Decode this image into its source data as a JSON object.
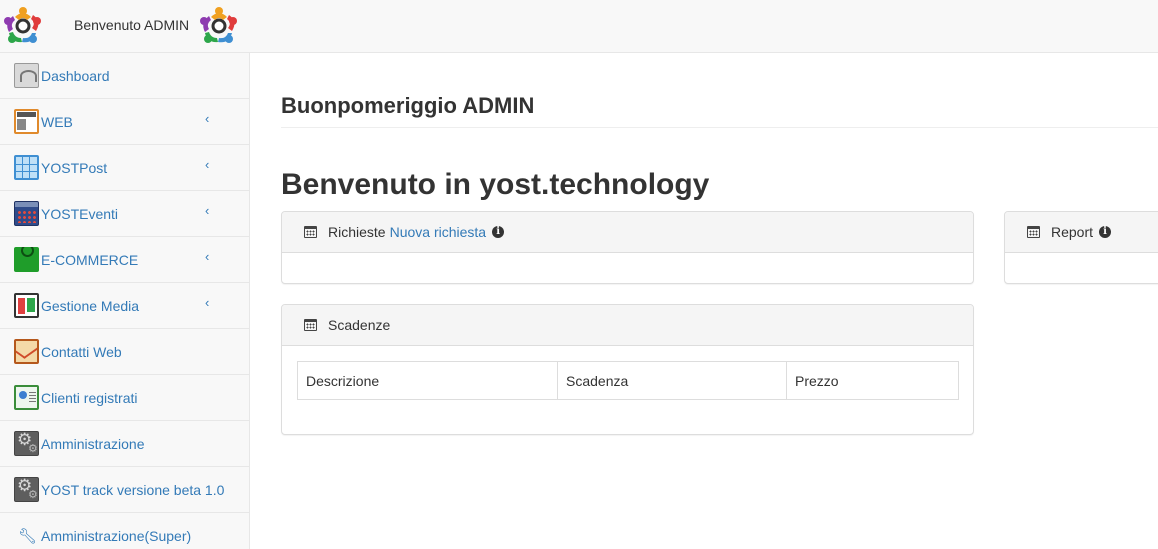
{
  "topbar": {
    "welcome": "Benvenuto ADMIN"
  },
  "sidebar": {
    "items": [
      {
        "label": "Dashboard",
        "icon": "dashboard-icon",
        "has_submenu": false
      },
      {
        "label": "WEB",
        "icon": "web-icon",
        "has_submenu": true
      },
      {
        "label": "YOSTPost",
        "icon": "grid-icon",
        "has_submenu": true
      },
      {
        "label": "YOSTEventi",
        "icon": "calendar-grid-icon",
        "has_submenu": true
      },
      {
        "label": "E-COMMERCE",
        "icon": "shopping-bag-icon",
        "has_submenu": true
      },
      {
        "label": "Gestione Media",
        "icon": "media-icon",
        "has_submenu": true
      },
      {
        "label": "Contatti Web",
        "icon": "mail-icon",
        "has_submenu": false
      },
      {
        "label": "Clienti registrati",
        "icon": "id-card-icon",
        "has_submenu": false
      },
      {
        "label": "Amministrazione",
        "icon": "gears-icon",
        "has_submenu": false
      },
      {
        "label": "YOST track versione beta 1.0",
        "icon": "gears-icon",
        "has_submenu": false
      },
      {
        "label": "Amministrazione(Super)",
        "icon": "wrench-icon",
        "has_submenu": false
      }
    ],
    "chevron": "‹"
  },
  "main": {
    "greeting": "Buonpomeriggio ADMIN",
    "welcome_heading": "Benvenuto in yost.technology",
    "richieste": {
      "title": "Richieste",
      "link": "Nuova richiesta",
      "info": "i"
    },
    "report": {
      "title": "Report",
      "info": "i"
    },
    "scadenze": {
      "title": "Scadenze",
      "columns": [
        "Descrizione",
        "Scadenza",
        "Prezzo"
      ]
    }
  },
  "colors": {
    "link": "#337ab7",
    "sidebar_bg": "#f8f8f8",
    "panel_heading_bg": "#f5f5f5",
    "border": "#dddddd"
  }
}
